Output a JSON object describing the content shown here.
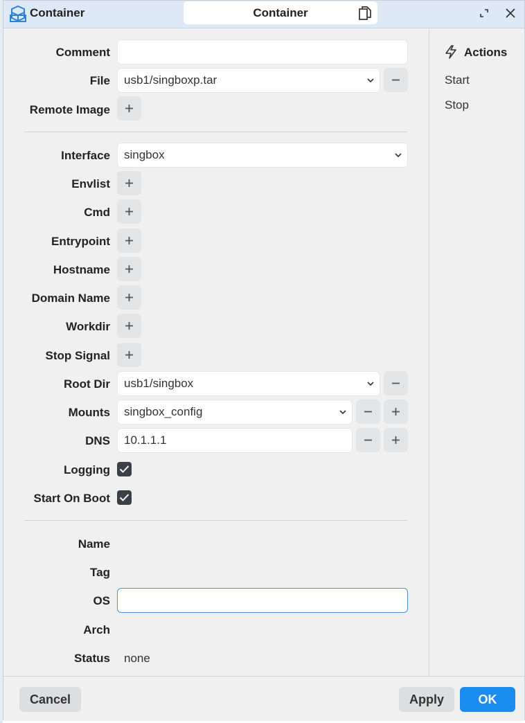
{
  "window": {
    "title": "Container",
    "tab_title": "Container"
  },
  "form": {
    "comment": {
      "label": "Comment",
      "value": ""
    },
    "file": {
      "label": "File",
      "value": "usb1/singboxp.tar"
    },
    "remote_image": {
      "label": "Remote Image"
    },
    "interface": {
      "label": "Interface",
      "value": "singbox"
    },
    "envlist": {
      "label": "Envlist"
    },
    "cmd": {
      "label": "Cmd"
    },
    "entrypoint": {
      "label": "Entrypoint"
    },
    "hostname": {
      "label": "Hostname"
    },
    "domain_name": {
      "label": "Domain Name"
    },
    "workdir": {
      "label": "Workdir"
    },
    "stop_signal": {
      "label": "Stop Signal"
    },
    "root_dir": {
      "label": "Root Dir",
      "value": "usb1/singbox"
    },
    "mounts": {
      "label": "Mounts",
      "value": "singbox_config"
    },
    "dns": {
      "label": "DNS",
      "value": "10.1.1.1"
    },
    "logging": {
      "label": "Logging",
      "checked": true
    },
    "start_on_boot": {
      "label": "Start On Boot",
      "checked": true
    },
    "name": {
      "label": "Name",
      "value": ""
    },
    "tag": {
      "label": "Tag",
      "value": ""
    },
    "os": {
      "label": "OS",
      "value": ""
    },
    "arch": {
      "label": "Arch",
      "value": ""
    },
    "status": {
      "label": "Status",
      "value": "none"
    }
  },
  "actions": {
    "title": "Actions",
    "items": [
      "Start",
      "Stop"
    ]
  },
  "buttons": {
    "cancel": "Cancel",
    "apply": "Apply",
    "ok": "OK"
  },
  "colors": {
    "accent": "#1a8cf0",
    "titlebar": "#dde9f6",
    "focus_border": "#4a8ed1"
  }
}
